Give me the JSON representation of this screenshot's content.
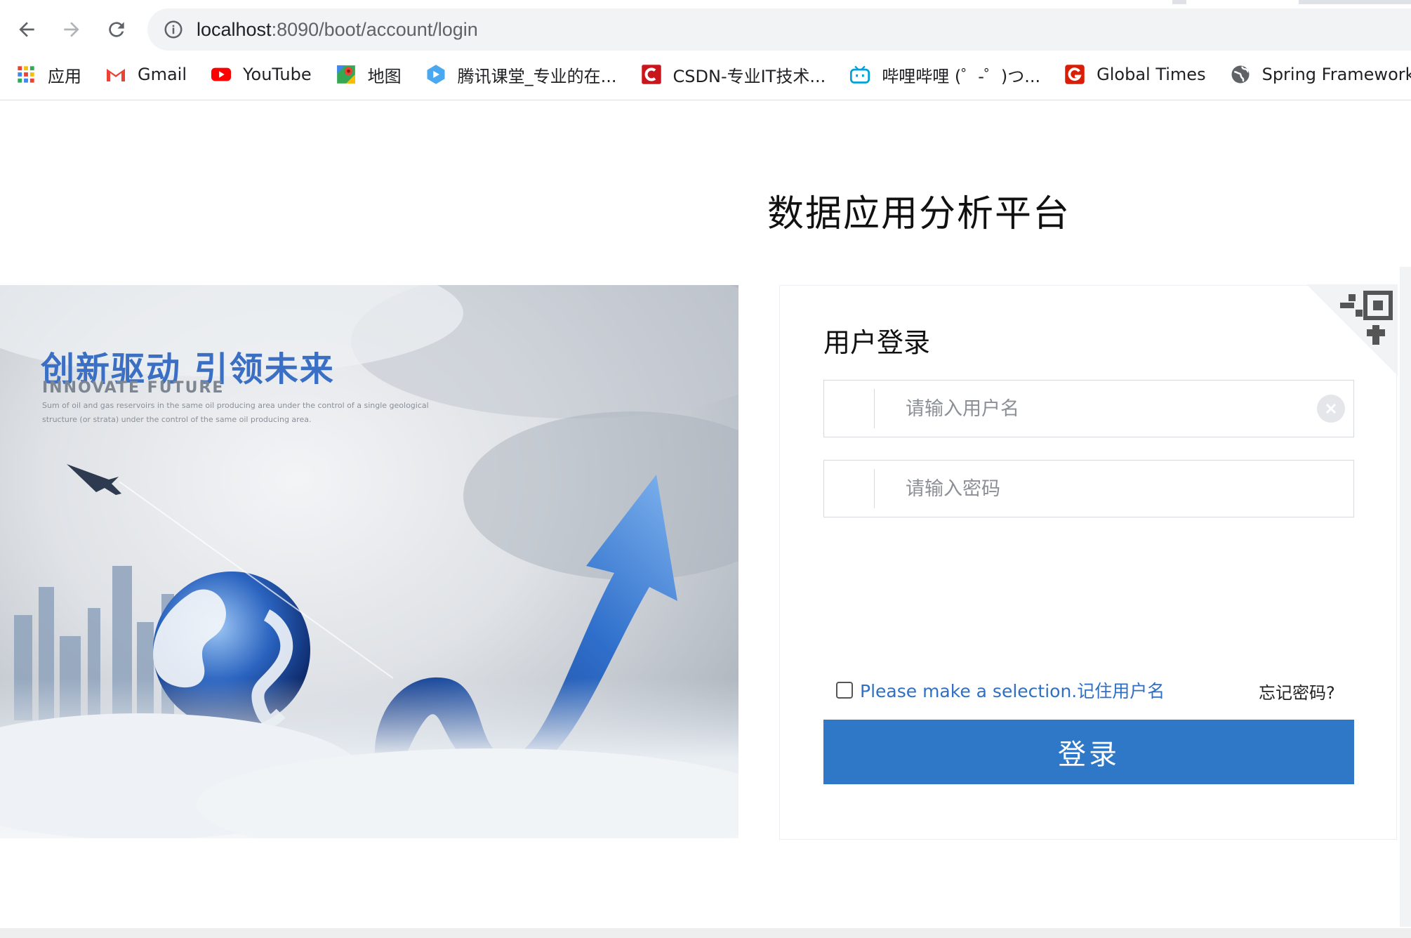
{
  "browser": {
    "url_host": "localhost",
    "url_path": ":8090/boot/account/login",
    "bookmarks": [
      {
        "label": "应用",
        "icon": "apps-grid-icon"
      },
      {
        "label": "Gmail",
        "icon": "gmail-icon"
      },
      {
        "label": "YouTube",
        "icon": "youtube-icon"
      },
      {
        "label": "地图",
        "icon": "maps-icon"
      },
      {
        "label": "腾讯课堂_专业的在...",
        "icon": "tencent-class-icon"
      },
      {
        "label": "CSDN-专业IT技术...",
        "icon": "csdn-icon"
      },
      {
        "label": "哔哩哔哩 (゜-゜)つ...",
        "icon": "bilibili-icon"
      },
      {
        "label": "Global Times",
        "icon": "global-times-icon"
      },
      {
        "label": "Spring Framework",
        "icon": "globe-icon"
      }
    ],
    "colors": {
      "youtube": "#ff0000",
      "csdn": "#c9161c",
      "global_times": "#d81e06",
      "bilibili": "#00a1d6"
    }
  },
  "page": {
    "title": "数据应用分析平台",
    "hero": {
      "headline": "创新驱动  引领未来",
      "subtitle": "INNOVATE   FUTURE",
      "small_text": "Sum of oil and gas reservoirs in the same oil producing area under the control of a single geological structure (or strata) under the control of the same oil producing area."
    },
    "login": {
      "heading": "用户登录",
      "username_placeholder": "请输入用户名",
      "password_placeholder": "请输入密码",
      "remember_label": "Please make a selection.记住用户名",
      "forgot_label": "忘记密码?",
      "submit_label": "登录",
      "colors": {
        "button": "#2f78c8",
        "link": "#2f6fc4"
      }
    }
  }
}
